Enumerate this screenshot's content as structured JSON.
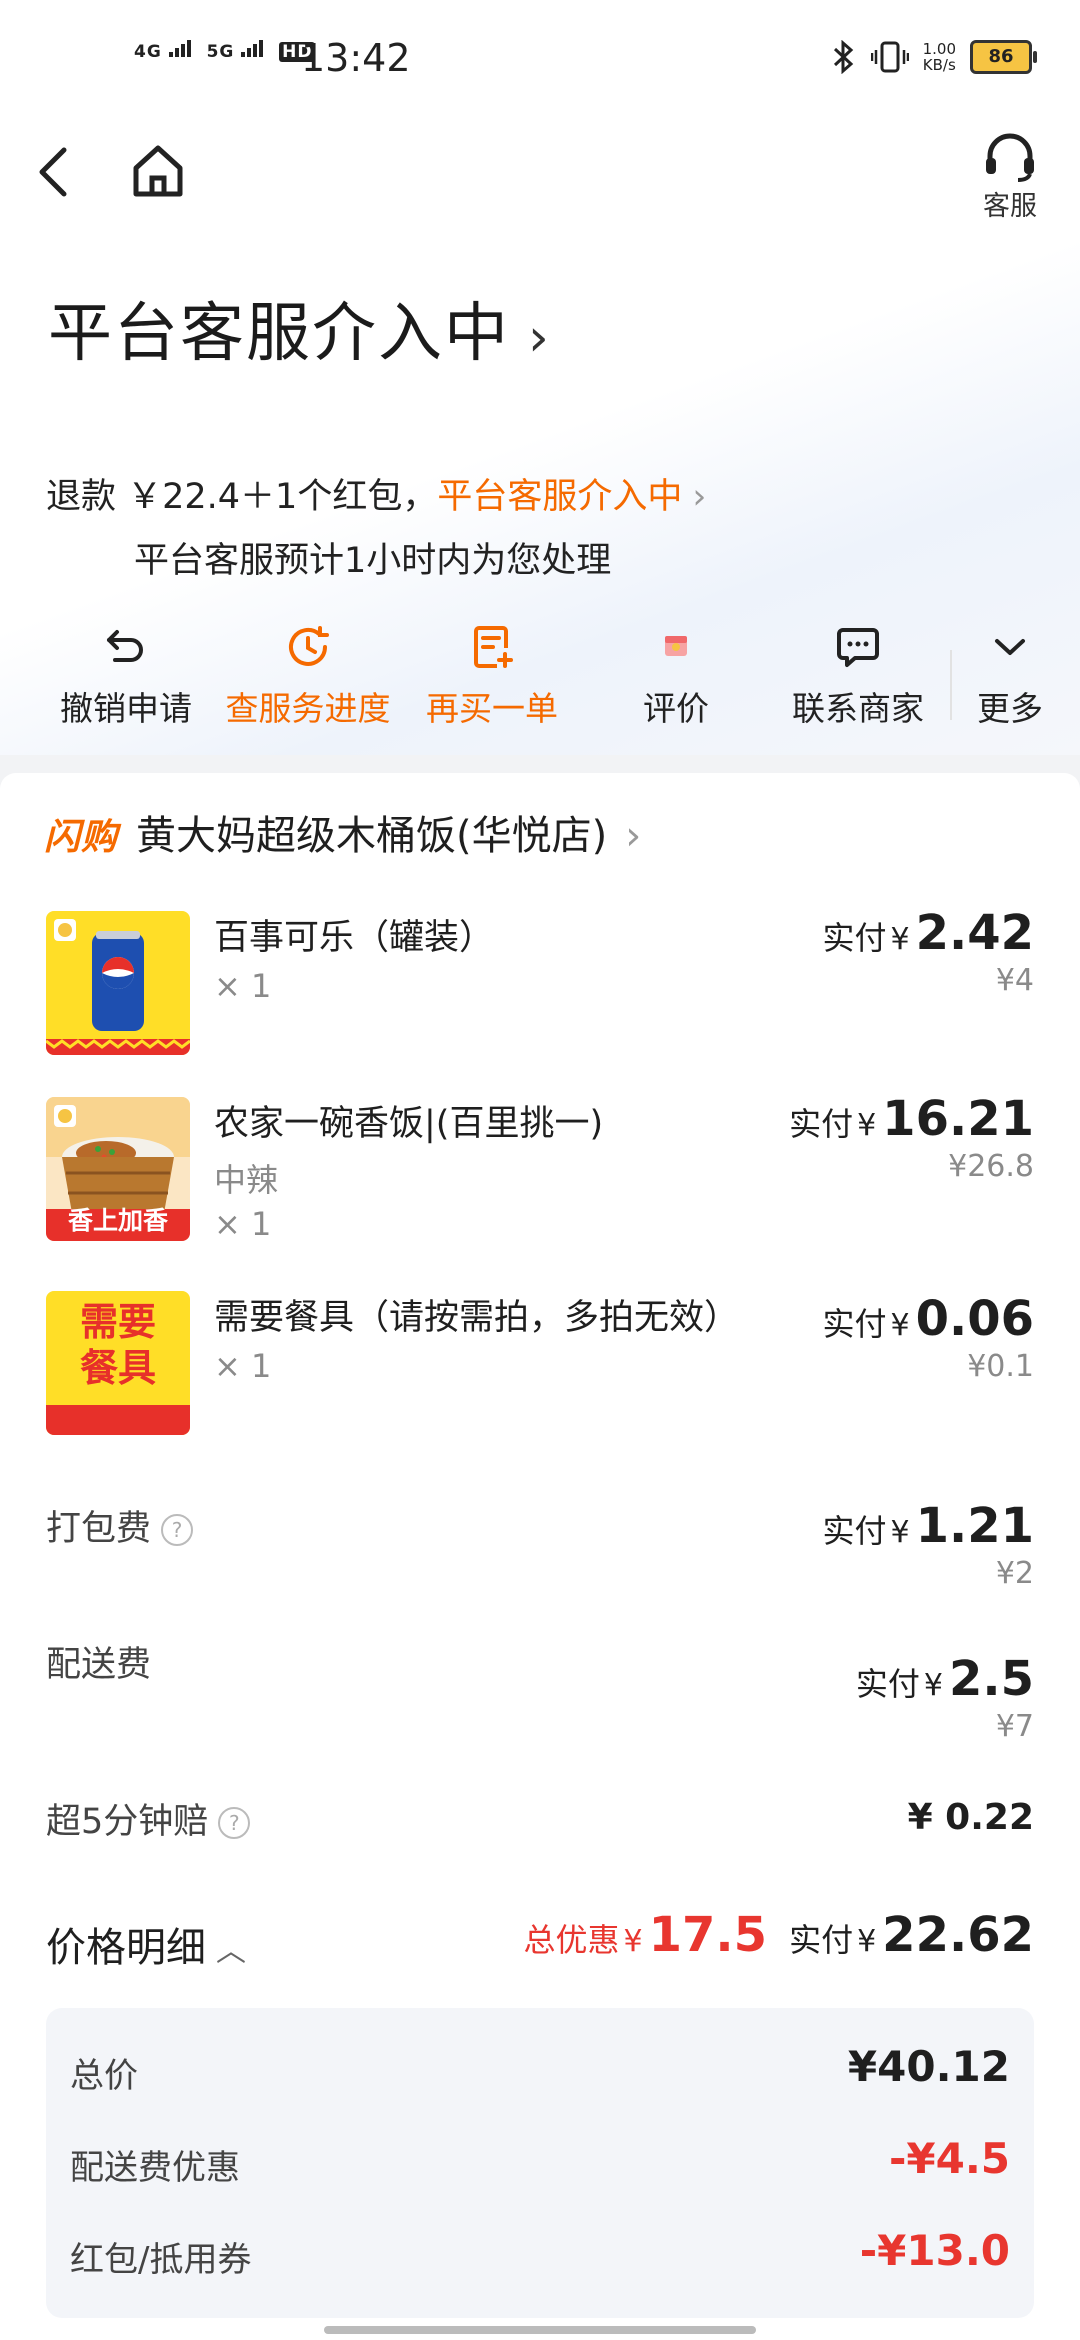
{
  "status_bar": {
    "net1": "4G",
    "net2": "5G",
    "hd": "HD",
    "time": "13:42",
    "speed_value": "1.00",
    "speed_unit": "KB/s",
    "battery": "86"
  },
  "nav": {
    "service_label": "客服"
  },
  "header": {
    "title": "平台客服介入中",
    "title_chevron": "›"
  },
  "refund": {
    "prefix": "退款 ￥22.4＋1个红包，",
    "status": "平台客服介入中",
    "chevron": "›",
    "note": "平台客服预计1小时内为您处理"
  },
  "actions": [
    {
      "label": "撤销申请",
      "icon": "undo-icon",
      "color": "#222222"
    },
    {
      "label": "查服务进度",
      "icon": "clock-icon",
      "color": "#f56a00"
    },
    {
      "label": "再买一单",
      "icon": "reorder-icon",
      "color": "#f56a00"
    },
    {
      "label": "评价",
      "icon": "review-gift-icon",
      "color": "#222222"
    },
    {
      "label": "联系商家",
      "icon": "chat-icon",
      "color": "#222222"
    },
    {
      "label": "更多",
      "icon": "chevron-down-icon",
      "color": "#222222"
    }
  ],
  "store": {
    "brand": "闪购",
    "name": "黄大妈超级木桶饭(华悦店)",
    "chevron": "›"
  },
  "items": [
    {
      "name": "百事可乐（罐装）",
      "spec": "",
      "qty": "× 1",
      "paid_label": "实付",
      "yen": "¥",
      "paid": "2.42",
      "original": "¥4",
      "image": "pepsi-can-image"
    },
    {
      "name": "农家一碗香饭|(百里挑一)",
      "spec": "中辣",
      "qty": "× 1",
      "paid_label": "实付",
      "yen": "¥",
      "paid": "16.21",
      "original": "¥26.8",
      "image": "rice-bowl-image",
      "image_text": "香上加香"
    },
    {
      "name": "需要餐具（请按需拍，多拍无效）",
      "spec": "",
      "qty": "× 1",
      "paid_label": "实付",
      "yen": "¥",
      "paid": "0.06",
      "original": "¥0.1",
      "image": "tableware-image",
      "image_text_1": "需要",
      "image_text_2": "餐具"
    }
  ],
  "fees": [
    {
      "label": "打包费",
      "paid_label": "实付",
      "yen": "¥",
      "paid": "1.21",
      "original": "¥2",
      "help": "?"
    },
    {
      "label": "配送费",
      "paid_label": "实付",
      "yen": "¥",
      "paid": "2.5",
      "original": "¥7"
    },
    {
      "label": "超5分钟赔",
      "value": "¥ 0.22",
      "help": "?"
    }
  ],
  "price_detail": {
    "title": "价格明细",
    "chevron": "︿",
    "discount_label": "总优惠",
    "yen": "¥",
    "discount": "17.5",
    "paid_label": "实付",
    "paid": "22.62"
  },
  "breakdown": [
    {
      "label": "总价",
      "value": "¥40.12",
      "negative": false
    },
    {
      "label": "配送费优惠",
      "value": "-¥4.5",
      "negative": true
    },
    {
      "label": "红包/抵用券",
      "value": "-¥13.0",
      "negative": true
    }
  ],
  "colors": {
    "accent_orange": "#f56a00",
    "discount_red": "#e8362f",
    "text_primary": "#1f1f1f",
    "text_secondary": "#8a8a8a"
  }
}
